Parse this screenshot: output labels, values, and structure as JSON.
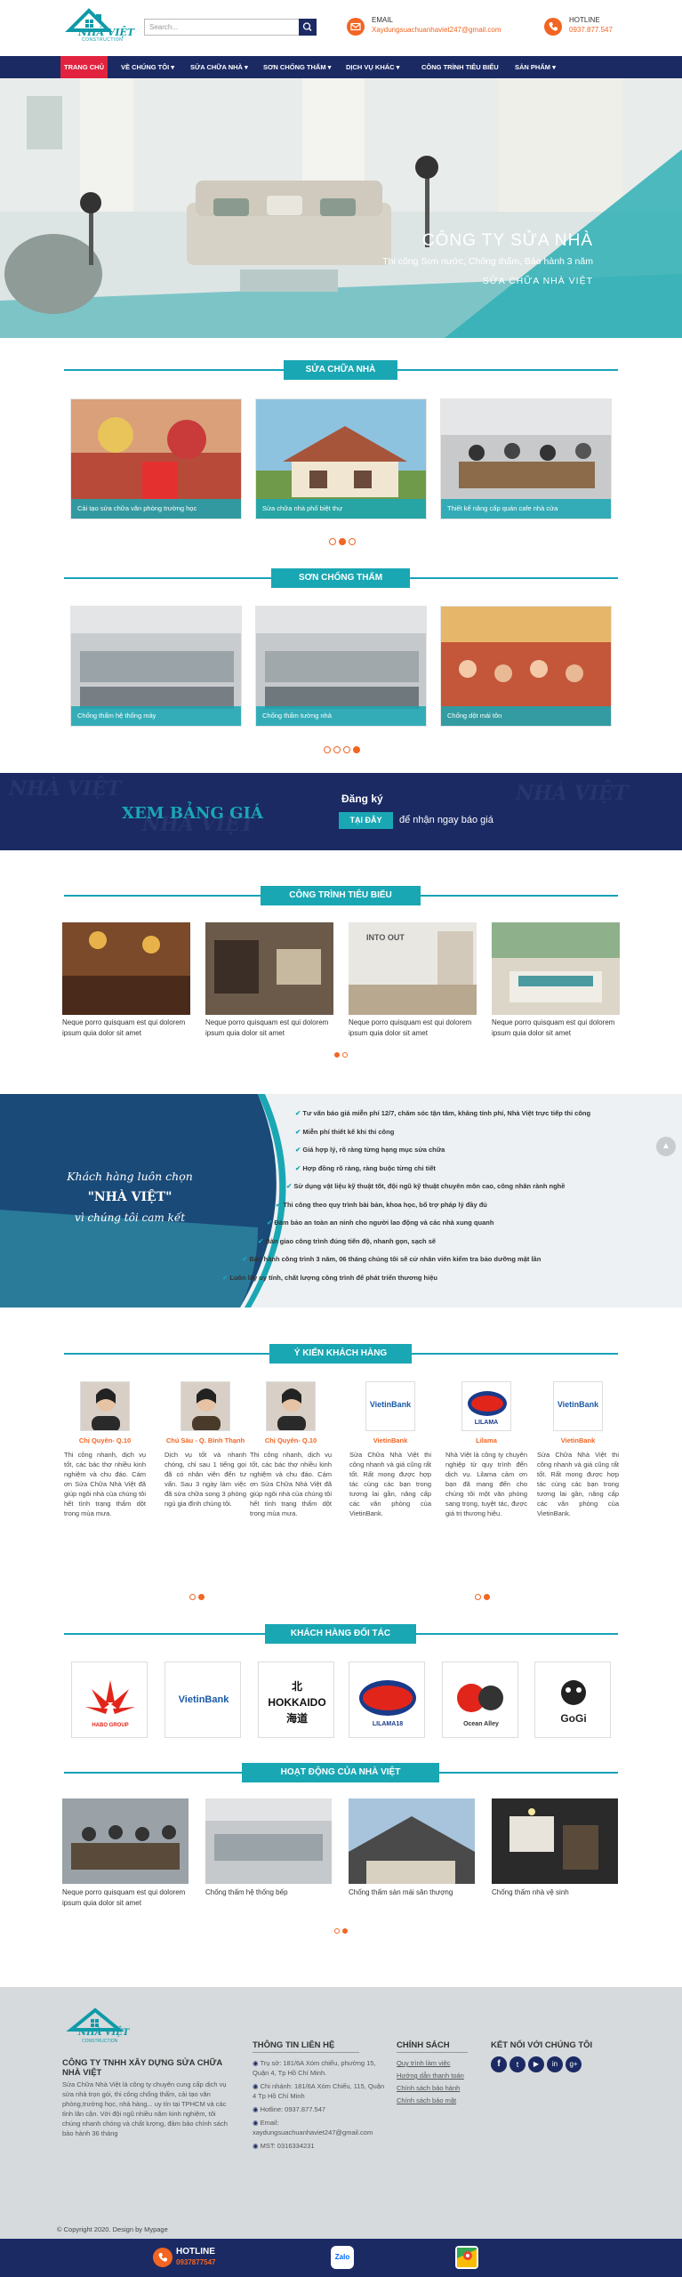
{
  "header": {
    "logo_text": "NHÀ VIỆT",
    "logo_sub": "CONSTRUCTION",
    "search_placeholder": "Search...",
    "email_label": "EMAIL",
    "email_value": "Xaydungsuachuanhaviet247@gmail.com",
    "hotline_label": "HOTLINE",
    "hotline_value": "0937.877.547"
  },
  "nav": [
    "TRANG CHỦ",
    "VỀ CHÚNG TÔI ▾",
    "SỬA CHỮA NHÀ ▾",
    "SƠN CHỐNG THẤM ▾",
    "DỊCH VỤ KHÁC ▾",
    "CÔNG TRÌNH TIÊU BIỂU",
    "SẢN PHẨM ▾"
  ],
  "banner": {
    "title": "CÔNG TY SỬA NHÀ",
    "subtitle": "Thi công Sơn nước, Chống thấm, Bảo hành 3 năm",
    "brand": "SỬA CHỮA NHÀ VIỆT"
  },
  "sua_chua": {
    "title": "SỬA CHỮA NHÀ",
    "items": [
      "Cải tạo sửa chữa văn phòng trường học",
      "Sửa chữa nhà phố biệt thự",
      "Thiết kế nâng cấp quán cafe nhà cửa"
    ]
  },
  "son": {
    "title": "SƠN CHỐNG THẤM",
    "items": [
      "Chống thấm hệ thống máy",
      "Chống thấm tường nhà",
      "Chống dột mái tôn"
    ]
  },
  "pricing": {
    "xem": "XEM BẢNG GIÁ",
    "dang_ky": "Đăng ký",
    "tai_day": "TẠI ĐÂY",
    "nhan": "để nhận ngay báo giá",
    "watermark": "NHÀ VIỆT"
  },
  "projects": {
    "title": "CÔNG TRÌNH TIÊU BIỂU",
    "caption": "Neque porro quisquam est qui dolorem ipsum quia dolor sit amet",
    "sign": "INTO OUT"
  },
  "commit": {
    "line1": "Khách hàng luôn chọn",
    "line2": "\"NHÀ VIỆT\"",
    "line3": "vì chúng tôi cam kết",
    "items": [
      "Tư vấn báo giá miễn phí 12/7, chăm sóc tận tâm, khăng tính phí, Nhà Việt trực tiếp thi công",
      "Miễn phí thiết kế khi thi công",
      "Giá hợp lý, rõ ràng từng hạng mục sửa chữa",
      "Hợp đồng rõ ràng, ràng buộc từng chi tiết",
      "Sử dụng vật liệu kỹ thuật tốt, đội ngũ kỹ thuật chuyên môn cao, công nhân rành nghề",
      "Thi công theo quy trình bài bản, khoa học, bổ trợ pháp lý đầy đủ",
      "Đảm bảo an toàn an ninh cho người lao động và các nhà xung quanh",
      "Bàn giao công trình đúng tiến độ, nhanh gọn, sạch sẽ",
      "Bảo hành công trình 3 năm, 06 tháng chúng tôi sẽ cử nhân viên kiểm tra bảo dưỡng mặt lần",
      "Luôn lấy uy tính, chất lượng công trình để phát triển thương hiệu"
    ]
  },
  "testimonials": {
    "title": "Ý KIẾN KHÁCH HÀNG",
    "items": [
      {
        "name": "Chị Quyên- Q.10",
        "text": "Thi công nhanh, dịch vụ tốt, các bác thợ nhiều kinh nghiệm và chu đáo. Cám ơn Sửa Chữa Nhà Việt đã giúp ngôi nhà của chúng tôi hết tình trạng thấm dột trong mùa mưa."
      },
      {
        "name": "Chú Sáu - Q. Bình Thạnh",
        "text": "Dịch vụ tốt và nhanh chóng, chỉ sau 1 tiếng gọi đã có nhân viên đến tư vấn. Sau 3 ngày làm việc đã sửa chữa song 3 phòng ngủ gia đình chúng tôi."
      },
      {
        "name": "Chị Quyên- Q.10",
        "text": "Thi công nhanh, dịch vụ tốt, các bác thợ nhiều kinh nghiệm và chu đáo. Cám ơn Sửa Chữa Nhà Việt đã giúp ngôi nhà của chúng tôi hết tình trạng thấm dột trong mùa mưa."
      },
      {
        "name": "VietinBank",
        "text": "Sửa Chữa Nhà Việt thi công nhanh và giá cũng rất tốt. Rất mong được hợp tác cùng các bạn trong tương lai gần, nâng cấp các văn phòng của VietinBank."
      },
      {
        "name": "Lilama",
        "text": "Nhà Việt là công ty chuyên nghiệp từ quy trình đến dịch vụ. Lilama cảm ơn bạn đã mang đến cho chúng tôi một văn phòng sang trọng, tuyệt tác, được giá trị thương hiệu."
      },
      {
        "name": "VietinBank",
        "text": "Sửa Chữa Nhà Việt thi công nhanh và giá cũng rất tốt. Rất mong được hợp tác cùng các bạn trong tương lai gần, nâng cấp các văn phòng của VietinBank."
      }
    ],
    "logo_vietin": "VietinBank",
    "logo_lilama": "LILAMA"
  },
  "partners": {
    "title": "KHÁCH HÀNG ĐỐI TÁC",
    "items": [
      "HABO GROUP",
      "VietinBank",
      "北 HOKKAIDO 海道",
      "LILAMA18",
      "Ocean Alley",
      "GoGi"
    ]
  },
  "activities": {
    "title": "HOẠT ĐỘNG CỦA NHÀ VIỆT",
    "items": [
      "Neque porro quisquam est qui dolorem ipsum quia dolor sit amet",
      "Chống thấm hệ thống bếp",
      "Chống thấm sàn mái sân thượng",
      "Chống thấm nhà vệ sinh"
    ]
  },
  "footer": {
    "company": "CÔNG TY TNHH XÂY DỰNG SỬA CHỮA NHÀ VIỆT",
    "about": "Sửa Chữa Nhà Việt là công ty chuyên cung cấp dịch vụ sửa nhà trọn gói, thi công chống thấm, cải tạo văn phòng,trường học, nhà hàng... uy tín tại TPHCM và các tỉnh lân cận. Với đội ngũ nhiều năm kinh nghiệm, tôi chúng nhanh chóng và chất lượng, đảm bảo chính sách bảo hành 36 tháng",
    "contact_title": "THÔNG TIN LIÊN HỆ",
    "contact": [
      "Trụ sở: 181/6A Xóm chiếu, phường 15, Quận 4, Tp Hồ Chí Minh.",
      "Chi nhánh: 181/6A Xóm Chiếu, 115, Quận 4 Tp Hồ Chí Minh",
      "Hotline: 0937.877.547",
      "Email: xaydungsuachuanhaviet247@gmail.com",
      "MST: 0316334231"
    ],
    "policy_title": "CHÍNH SÁCH",
    "policies": [
      "Quy trình làm việc",
      "Hướng dẫn thanh toán",
      "Chính sách bảo hành",
      "Chính sách bảo mật"
    ],
    "social_title": "KẾT NỐI VỚI CHÚNG TÔI",
    "copyright": "© Copyright 2020. Design by Mypage"
  },
  "bottom": {
    "hotline": "HOTLINE",
    "phone": "0937877547",
    "zalo": "Zalo"
  }
}
